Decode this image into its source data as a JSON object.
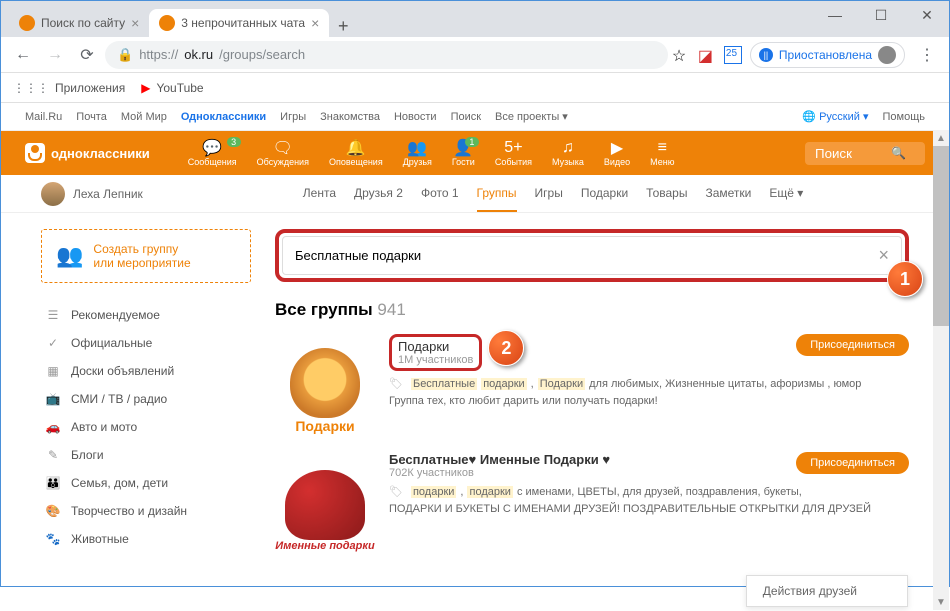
{
  "window": {
    "tabs": [
      {
        "title": "Поиск по сайту",
        "favicon_color": "#ee8208"
      },
      {
        "title": "3 непрочитанных чата",
        "favicon_color": "#ee8208"
      }
    ]
  },
  "browser": {
    "url_scheme": "https://",
    "url_host": "ok.ru",
    "url_path": "/groups/search",
    "paused_label": "Приостановлена",
    "bookmarks": {
      "apps": "Приложения",
      "youtube": "YouTube"
    }
  },
  "portal_links": [
    "Mail.Ru",
    "Почта",
    "Мой Мир",
    "Одноклассники",
    "Игры",
    "Знакомства",
    "Новости",
    "Поиск",
    "Все проекты"
  ],
  "portal_right": {
    "lang": "Русский",
    "help": "Помощь"
  },
  "header": {
    "brand": "одноклассники",
    "nav": [
      {
        "label": "Сообщения",
        "badge": "3"
      },
      {
        "label": "Обсуждения",
        "badge": ""
      },
      {
        "label": "Оповещения",
        "badge": ""
      },
      {
        "label": "Друзья",
        "badge": ""
      },
      {
        "label": "Гости",
        "badge": "1"
      },
      {
        "label": "События",
        "badge": ""
      },
      {
        "label": "Музыка",
        "badge": ""
      },
      {
        "label": "Видео",
        "badge": ""
      },
      {
        "label": "Меню",
        "badge": ""
      }
    ],
    "search_placeholder": "Поиск"
  },
  "user": {
    "name": "Леха Лепник",
    "tabs": [
      "Лента",
      "Друзья 2",
      "Фото 1",
      "Группы",
      "Игры",
      "Подарки",
      "Товары",
      "Заметки",
      "Ещё"
    ]
  },
  "sidebar": {
    "create_l1": "Создать группу",
    "create_l2": "или мероприятие",
    "items": [
      "Рекомендуемое",
      "Официальные",
      "Доски объявлений",
      "СМИ / ТВ / радио",
      "Авто и мото",
      "Блоги",
      "Семья, дом, дети",
      "Творчество и дизайн",
      "Животные"
    ]
  },
  "search": {
    "value": "Бесплатные подарки"
  },
  "results": {
    "title": "Все группы",
    "count": "941",
    "groups": [
      {
        "name": "Подарки",
        "members": "1М участников",
        "img_label": "Подарки",
        "tags_html": "Бесплатные подарки, Подарки для любимых, Жизненные цитаты, афоризмы , юмор",
        "tag1": "Бесплатные",
        "tag2": "подарки",
        "tag3": "Подарки",
        "tag_rest": " для любимых, Жизненные цитаты, афоризмы , юмор",
        "desc": "Группа тех, кто любит дарить или получать подарки!",
        "join": "Присоединиться"
      },
      {
        "name": "Бесплатные♥ Именные Подарки ♥",
        "members": "702К участников",
        "img_label": "Именные подарки",
        "tag1": "подарки",
        "tag2": "подарки",
        "tag_rest": " с именами, ЦВЕТЫ, для друзей, поздравления, букеты,",
        "desc": "ПОДАРКИ И БУКЕТЫ С ИМЕНАМИ ДРУЗЕЙ! ПОЗДРАВИТЕЛЬНЫЕ ОТКРЫТКИ ДЛЯ ДРУЗЕЙ",
        "join": "Присоединиться"
      }
    ]
  },
  "popup": {
    "friends_actions": "Действия друзей"
  },
  "callouts": {
    "one": "1",
    "two": "2"
  }
}
